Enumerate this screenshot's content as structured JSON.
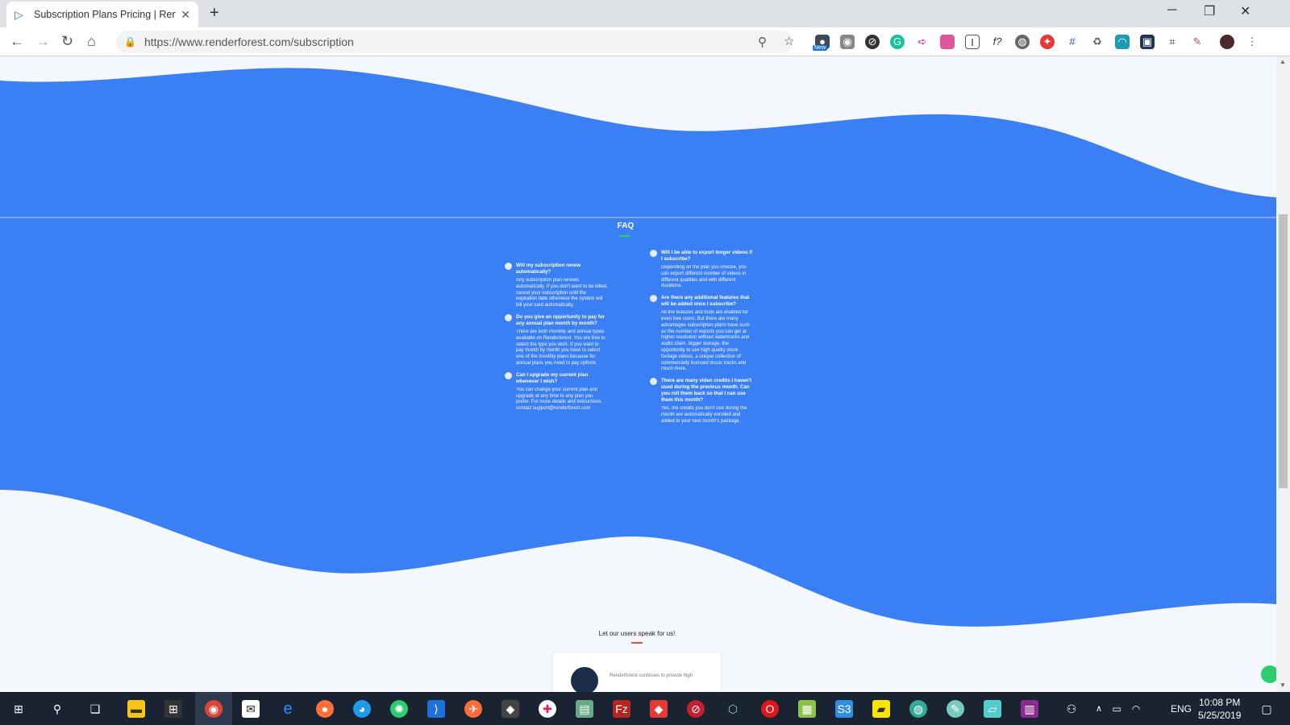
{
  "browser": {
    "tab_title": "Subscription Plans Pricing | Rend",
    "url": "https://www.renderforest.com/subscription",
    "ext_badge": "New"
  },
  "faq": {
    "title": "FAQ",
    "left": [
      {
        "q": "Will my subscription renew automatically?",
        "a": "Any subscription plan renews automatically. If you don't want to be billed, cancel your subscription until the expiration date otherwise the system will bill your card automatically."
      },
      {
        "q": "Do you give an opportunity to pay for any annual plan month by month?",
        "a": "There are both monthly and annual types available on Renderforest. You are free to select the type you wish. If you want to pay month by month you have to select one of the monthly plans because for annual plans you need to pay upfront."
      },
      {
        "q": "Can I upgrade my current plan whenever I wish?",
        "a": "You can change your current plan and upgrade at any time to any plan you prefer. For more details and instructions contact support@renderforest.com"
      }
    ],
    "right": [
      {
        "q": "Will I be able to export longer videos if I subscribe?",
        "a": "Depending on the plan you choose, you can export different number of videos in different qualities and with different durations."
      },
      {
        "q": "Are there any additional features that will be added once I subscribe?",
        "a": "All the features and tools are enabled for even free users. But there are many advantages subscription plans have such as the number of exports you can get at higher resolution without watermarks and audio claim, bigger storage, the opportunity to use high quality stock footage videos, a unique collection of commercially licensed music tracks and much more."
      },
      {
        "q": "There are many video credits I haven't used during the previous month. Can you roll them back so that I can use them this month?",
        "a": "Yes, the credits you don't use during the month are automatically enrolled and added to your next month's package."
      }
    ]
  },
  "users": {
    "title": "Let our users speak for us!",
    "testimonial_snippet": "Renderforest continues to provide high"
  },
  "taskbar": {
    "lang": "ENG",
    "time": "10:08 PM",
    "date": "5/25/2019"
  },
  "colors": {
    "wave_blue": "#3b7ff5",
    "page_bg": "#f4f8fd",
    "faq_accent": "#2ecc71",
    "users_accent": "#e74c3c"
  }
}
